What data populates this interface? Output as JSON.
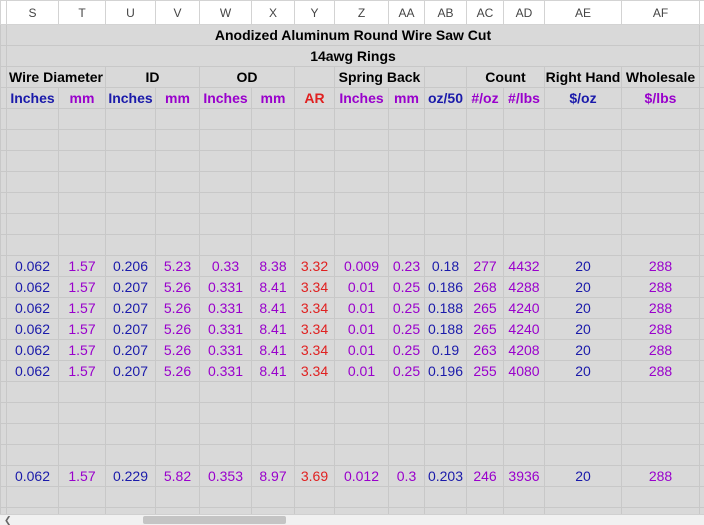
{
  "columns": [
    "S",
    "T",
    "U",
    "V",
    "W",
    "X",
    "Y",
    "Z",
    "AA",
    "AB",
    "AC",
    "AD",
    "AE",
    "AF"
  ],
  "title": "Anodized Aluminum Round Wire Saw Cut",
  "subtitle": "14awg Rings",
  "groups": {
    "wire_diameter": "Wire Diameter",
    "id": "ID",
    "od": "OD",
    "spring_back": "Spring Back",
    "count": "Count",
    "right_hand": "Right Hand",
    "wholesale": "Wholesale"
  },
  "units": [
    "Inches",
    "mm",
    "Inches",
    "mm",
    "Inches",
    "mm",
    "AR",
    "Inches",
    "mm",
    "oz/50",
    "#/oz",
    "#/lbs",
    "$/oz",
    "$/lbs"
  ],
  "rows": [
    [
      "0.062",
      "1.57",
      "0.206",
      "5.23",
      "0.33",
      "8.38",
      "3.32",
      "0.009",
      "0.23",
      "0.18",
      "277",
      "4432",
      "20",
      "288"
    ],
    [
      "0.062",
      "1.57",
      "0.207",
      "5.26",
      "0.331",
      "8.41",
      "3.34",
      "0.01",
      "0.25",
      "0.186",
      "268",
      "4288",
      "20",
      "288"
    ],
    [
      "0.062",
      "1.57",
      "0.207",
      "5.26",
      "0.331",
      "8.41",
      "3.34",
      "0.01",
      "0.25",
      "0.188",
      "265",
      "4240",
      "20",
      "288"
    ],
    [
      "0.062",
      "1.57",
      "0.207",
      "5.26",
      "0.331",
      "8.41",
      "3.34",
      "0.01",
      "0.25",
      "0.188",
      "265",
      "4240",
      "20",
      "288"
    ],
    [
      "0.062",
      "1.57",
      "0.207",
      "5.26",
      "0.331",
      "8.41",
      "3.34",
      "0.01",
      "0.25",
      "0.19",
      "263",
      "4208",
      "20",
      "288"
    ],
    [
      "0.062",
      "1.57",
      "0.207",
      "5.26",
      "0.331",
      "8.41",
      "3.34",
      "0.01",
      "0.25",
      "0.196",
      "255",
      "4080",
      "20",
      "288"
    ]
  ],
  "last_row": [
    "0.062",
    "1.57",
    "0.229",
    "5.82",
    "0.353",
    "8.97",
    "3.69",
    "0.012",
    "0.3",
    "0.203",
    "246",
    "3936",
    "20",
    "288"
  ],
  "colors": {
    "blue": "#1a1aaa",
    "purple": "#9900cc",
    "red": "#e02020",
    "cell_bg": "#d9d9d9"
  }
}
